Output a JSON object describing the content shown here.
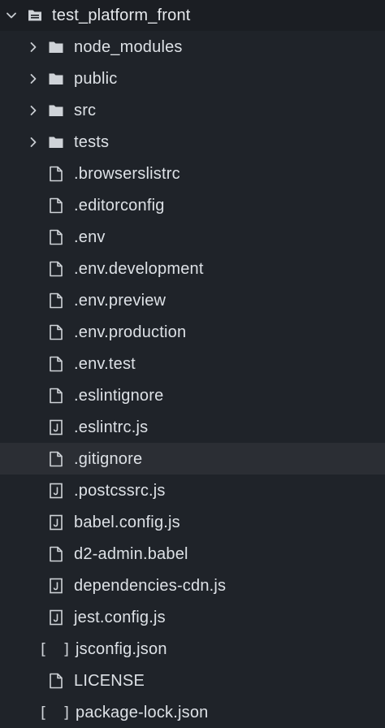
{
  "root": {
    "label": "test_platform_front",
    "icon": "folder-open-icon"
  },
  "folders": [
    {
      "label": "node_modules",
      "icon": "folder-icon"
    },
    {
      "label": "public",
      "icon": "folder-icon"
    },
    {
      "label": "src",
      "icon": "folder-icon"
    },
    {
      "label": "tests",
      "icon": "folder-icon"
    }
  ],
  "files": [
    {
      "label": ".browserslistrc",
      "icon": "file-icon"
    },
    {
      "label": ".editorconfig",
      "icon": "file-icon"
    },
    {
      "label": ".env",
      "icon": "file-icon"
    },
    {
      "label": ".env.development",
      "icon": "file-icon"
    },
    {
      "label": ".env.preview",
      "icon": "file-icon"
    },
    {
      "label": ".env.production",
      "icon": "file-icon"
    },
    {
      "label": ".env.test",
      "icon": "file-icon"
    },
    {
      "label": ".eslintignore",
      "icon": "file-icon"
    },
    {
      "label": ".eslintrc.js",
      "icon": "js-file-icon"
    },
    {
      "label": ".gitignore",
      "icon": "file-icon",
      "selected": true
    },
    {
      "label": ".postcssrc.js",
      "icon": "js-file-icon"
    },
    {
      "label": "babel.config.js",
      "icon": "js-file-icon"
    },
    {
      "label": "d2-admin.babel",
      "icon": "file-icon"
    },
    {
      "label": "dependencies-cdn.js",
      "icon": "js-file-icon"
    },
    {
      "label": "jest.config.js",
      "icon": "js-file-icon"
    },
    {
      "label": "jsconfig.json",
      "icon": "json-file-icon",
      "glyph": "[ ]"
    },
    {
      "label": "LICENSE",
      "icon": "file-icon"
    },
    {
      "label": "package-lock.json",
      "icon": "json-file-icon",
      "glyph": "[ ]"
    }
  ],
  "colors": {
    "background": "#1f2329",
    "selected_row": "#2b2e34",
    "text": "#dde1e6",
    "icon": "#cfd3d8"
  }
}
